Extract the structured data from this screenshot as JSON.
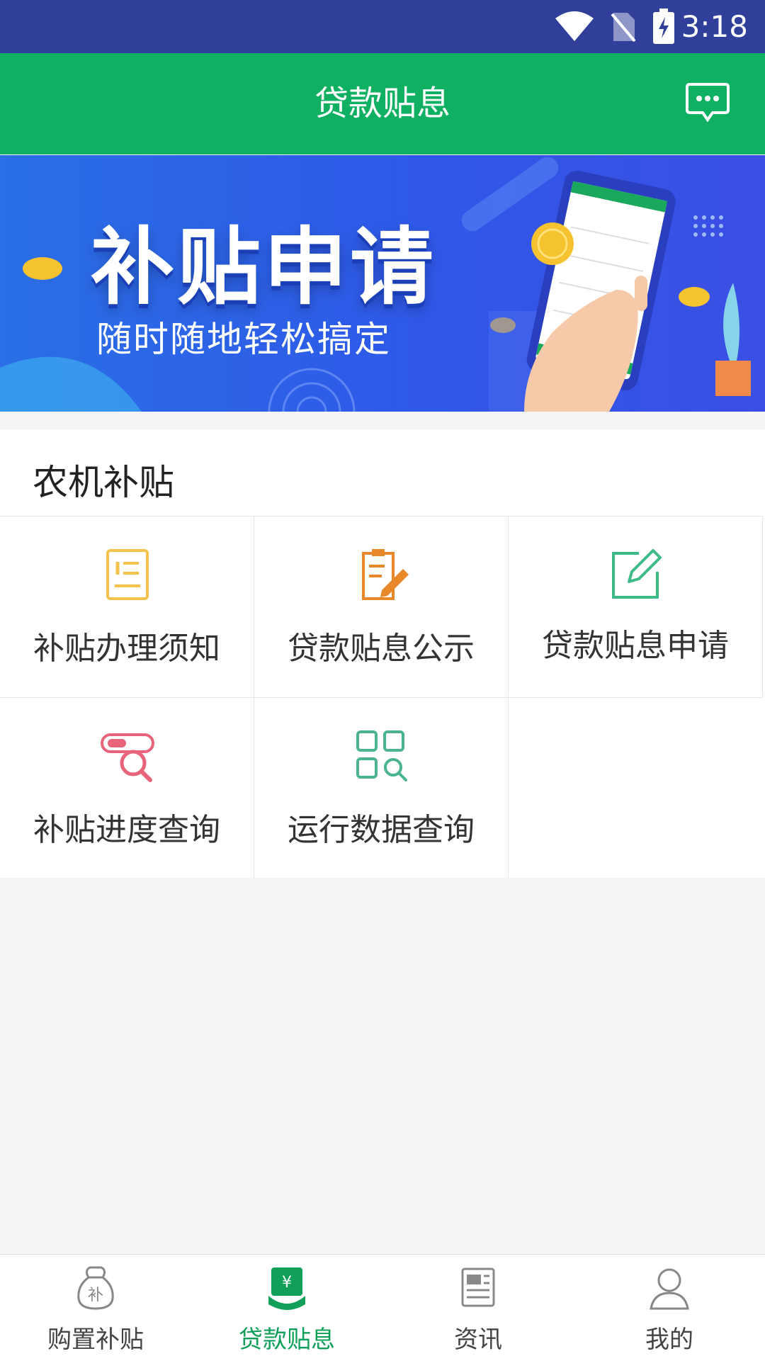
{
  "status_bar": {
    "time": "3:18"
  },
  "header": {
    "title": "贷款贴息",
    "message_icon": "message-icon"
  },
  "banner": {
    "headline": "补贴申请",
    "subline": "随时随地轻松搞定"
  },
  "section": {
    "title": "农机补贴",
    "items": [
      {
        "label": "补贴办理须知",
        "icon": "notice-icon",
        "color": "#f2c14e"
      },
      {
        "label": "贷款贴息公示",
        "icon": "announcement-icon",
        "color": "#e8882a"
      },
      {
        "label": "贷款贴息申请",
        "icon": "edit-icon",
        "color": "#3dbb86"
      },
      {
        "label": "补贴进度查询",
        "icon": "progress-search-icon",
        "color": "#e8647a"
      },
      {
        "label": "运行数据查询",
        "icon": "data-search-icon",
        "color": "#49b48e"
      }
    ]
  },
  "bottom_nav": {
    "items": [
      {
        "label": "购置补贴",
        "icon": "subsidy-bag-icon"
      },
      {
        "label": "贷款贴息",
        "icon": "loan-icon",
        "active": true
      },
      {
        "label": "资讯",
        "icon": "news-icon"
      },
      {
        "label": "我的",
        "icon": "profile-icon"
      }
    ]
  },
  "colors": {
    "primary": "#10b062",
    "status_bar": "#30409a",
    "banner": "#2f58e8"
  }
}
